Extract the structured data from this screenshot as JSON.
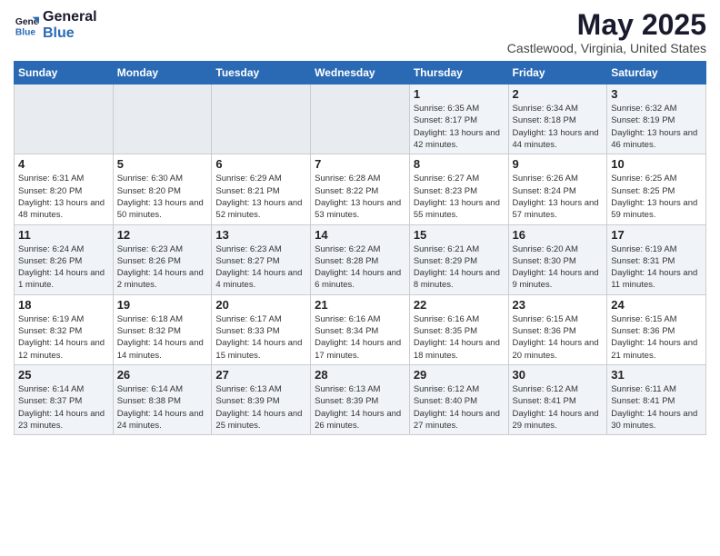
{
  "header": {
    "logo_general": "General",
    "logo_blue": "Blue",
    "main_title": "May 2025",
    "sub_title": "Castlewood, Virginia, United States"
  },
  "days_of_week": [
    "Sunday",
    "Monday",
    "Tuesday",
    "Wednesday",
    "Thursday",
    "Friday",
    "Saturday"
  ],
  "weeks": [
    [
      {
        "day": "",
        "sunrise": "",
        "sunset": "",
        "daylight": ""
      },
      {
        "day": "",
        "sunrise": "",
        "sunset": "",
        "daylight": ""
      },
      {
        "day": "",
        "sunrise": "",
        "sunset": "",
        "daylight": ""
      },
      {
        "day": "",
        "sunrise": "",
        "sunset": "",
        "daylight": ""
      },
      {
        "day": "1",
        "sunrise": "Sunrise: 6:35 AM",
        "sunset": "Sunset: 8:17 PM",
        "daylight": "Daylight: 13 hours and 42 minutes."
      },
      {
        "day": "2",
        "sunrise": "Sunrise: 6:34 AM",
        "sunset": "Sunset: 8:18 PM",
        "daylight": "Daylight: 13 hours and 44 minutes."
      },
      {
        "day": "3",
        "sunrise": "Sunrise: 6:32 AM",
        "sunset": "Sunset: 8:19 PM",
        "daylight": "Daylight: 13 hours and 46 minutes."
      }
    ],
    [
      {
        "day": "4",
        "sunrise": "Sunrise: 6:31 AM",
        "sunset": "Sunset: 8:20 PM",
        "daylight": "Daylight: 13 hours and 48 minutes."
      },
      {
        "day": "5",
        "sunrise": "Sunrise: 6:30 AM",
        "sunset": "Sunset: 8:20 PM",
        "daylight": "Daylight: 13 hours and 50 minutes."
      },
      {
        "day": "6",
        "sunrise": "Sunrise: 6:29 AM",
        "sunset": "Sunset: 8:21 PM",
        "daylight": "Daylight: 13 hours and 52 minutes."
      },
      {
        "day": "7",
        "sunrise": "Sunrise: 6:28 AM",
        "sunset": "Sunset: 8:22 PM",
        "daylight": "Daylight: 13 hours and 53 minutes."
      },
      {
        "day": "8",
        "sunrise": "Sunrise: 6:27 AM",
        "sunset": "Sunset: 8:23 PM",
        "daylight": "Daylight: 13 hours and 55 minutes."
      },
      {
        "day": "9",
        "sunrise": "Sunrise: 6:26 AM",
        "sunset": "Sunset: 8:24 PM",
        "daylight": "Daylight: 13 hours and 57 minutes."
      },
      {
        "day": "10",
        "sunrise": "Sunrise: 6:25 AM",
        "sunset": "Sunset: 8:25 PM",
        "daylight": "Daylight: 13 hours and 59 minutes."
      }
    ],
    [
      {
        "day": "11",
        "sunrise": "Sunrise: 6:24 AM",
        "sunset": "Sunset: 8:26 PM",
        "daylight": "Daylight: 14 hours and 1 minute."
      },
      {
        "day": "12",
        "sunrise": "Sunrise: 6:23 AM",
        "sunset": "Sunset: 8:26 PM",
        "daylight": "Daylight: 14 hours and 2 minutes."
      },
      {
        "day": "13",
        "sunrise": "Sunrise: 6:23 AM",
        "sunset": "Sunset: 8:27 PM",
        "daylight": "Daylight: 14 hours and 4 minutes."
      },
      {
        "day": "14",
        "sunrise": "Sunrise: 6:22 AM",
        "sunset": "Sunset: 8:28 PM",
        "daylight": "Daylight: 14 hours and 6 minutes."
      },
      {
        "day": "15",
        "sunrise": "Sunrise: 6:21 AM",
        "sunset": "Sunset: 8:29 PM",
        "daylight": "Daylight: 14 hours and 8 minutes."
      },
      {
        "day": "16",
        "sunrise": "Sunrise: 6:20 AM",
        "sunset": "Sunset: 8:30 PM",
        "daylight": "Daylight: 14 hours and 9 minutes."
      },
      {
        "day": "17",
        "sunrise": "Sunrise: 6:19 AM",
        "sunset": "Sunset: 8:31 PM",
        "daylight": "Daylight: 14 hours and 11 minutes."
      }
    ],
    [
      {
        "day": "18",
        "sunrise": "Sunrise: 6:19 AM",
        "sunset": "Sunset: 8:32 PM",
        "daylight": "Daylight: 14 hours and 12 minutes."
      },
      {
        "day": "19",
        "sunrise": "Sunrise: 6:18 AM",
        "sunset": "Sunset: 8:32 PM",
        "daylight": "Daylight: 14 hours and 14 minutes."
      },
      {
        "day": "20",
        "sunrise": "Sunrise: 6:17 AM",
        "sunset": "Sunset: 8:33 PM",
        "daylight": "Daylight: 14 hours and 15 minutes."
      },
      {
        "day": "21",
        "sunrise": "Sunrise: 6:16 AM",
        "sunset": "Sunset: 8:34 PM",
        "daylight": "Daylight: 14 hours and 17 minutes."
      },
      {
        "day": "22",
        "sunrise": "Sunrise: 6:16 AM",
        "sunset": "Sunset: 8:35 PM",
        "daylight": "Daylight: 14 hours and 18 minutes."
      },
      {
        "day": "23",
        "sunrise": "Sunrise: 6:15 AM",
        "sunset": "Sunset: 8:36 PM",
        "daylight": "Daylight: 14 hours and 20 minutes."
      },
      {
        "day": "24",
        "sunrise": "Sunrise: 6:15 AM",
        "sunset": "Sunset: 8:36 PM",
        "daylight": "Daylight: 14 hours and 21 minutes."
      }
    ],
    [
      {
        "day": "25",
        "sunrise": "Sunrise: 6:14 AM",
        "sunset": "Sunset: 8:37 PM",
        "daylight": "Daylight: 14 hours and 23 minutes."
      },
      {
        "day": "26",
        "sunrise": "Sunrise: 6:14 AM",
        "sunset": "Sunset: 8:38 PM",
        "daylight": "Daylight: 14 hours and 24 minutes."
      },
      {
        "day": "27",
        "sunrise": "Sunrise: 6:13 AM",
        "sunset": "Sunset: 8:39 PM",
        "daylight": "Daylight: 14 hours and 25 minutes."
      },
      {
        "day": "28",
        "sunrise": "Sunrise: 6:13 AM",
        "sunset": "Sunset: 8:39 PM",
        "daylight": "Daylight: 14 hours and 26 minutes."
      },
      {
        "day": "29",
        "sunrise": "Sunrise: 6:12 AM",
        "sunset": "Sunset: 8:40 PM",
        "daylight": "Daylight: 14 hours and 27 minutes."
      },
      {
        "day": "30",
        "sunrise": "Sunrise: 6:12 AM",
        "sunset": "Sunset: 8:41 PM",
        "daylight": "Daylight: 14 hours and 29 minutes."
      },
      {
        "day": "31",
        "sunrise": "Sunrise: 6:11 AM",
        "sunset": "Sunset: 8:41 PM",
        "daylight": "Daylight: 14 hours and 30 minutes."
      }
    ]
  ]
}
